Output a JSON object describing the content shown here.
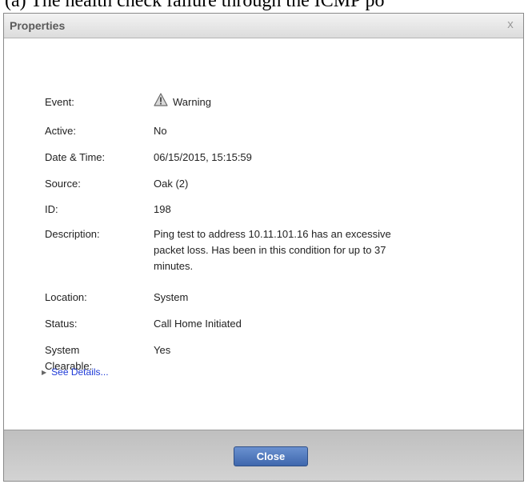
{
  "caption": "(a)  The health check failure through the ICMP po",
  "dialog": {
    "title": "Properties",
    "close_glyph": "x",
    "close_button_label": "Close"
  },
  "properties": {
    "event": {
      "label": "Event:",
      "value": "Warning",
      "icon": "warning-triangle-icon"
    },
    "active": {
      "label": "Active:",
      "value": "No"
    },
    "datetime": {
      "label": "Date & Time:",
      "value": "06/15/2015, 15:15:59"
    },
    "source": {
      "label": "Source:",
      "value": "Oak (2)"
    },
    "id": {
      "label": "ID:",
      "value": "198"
    },
    "description": {
      "label": "Description:",
      "lines": [
        "Ping test to address 10.11.101.16 has an excessive",
        "packet loss. Has been in this condition for up to 37",
        "minutes."
      ]
    },
    "location": {
      "label": "Location:",
      "value": "System"
    },
    "status": {
      "label": "Status:",
      "value": "Call Home Initiated"
    },
    "system_clearable": {
      "label_lines": [
        "System",
        "Clearable:"
      ],
      "value": "Yes"
    }
  },
  "see_details": {
    "label": "See Details...",
    "color": "#1f3bd7"
  },
  "colors": {
    "button": "#4a74bb",
    "link": "#1f3bd7"
  }
}
